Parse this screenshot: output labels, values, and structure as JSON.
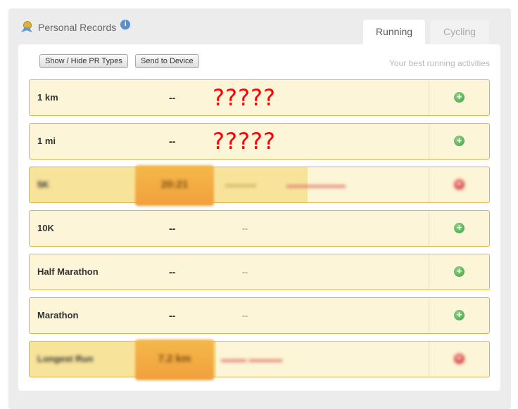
{
  "header": {
    "title": "Personal Records",
    "icon": "medal-icon",
    "info_icon": "info-icon"
  },
  "tabs": [
    {
      "label": "Running",
      "active": true
    },
    {
      "label": "Cycling",
      "active": false
    }
  ],
  "toolbar": {
    "show_hide": "Show / Hide PR Types",
    "send": "Send to Device"
  },
  "subtitle": "Your best running activities",
  "annotation": "?????",
  "rows": [
    {
      "name": "1 km",
      "time": "--",
      "date": "",
      "action": "add"
    },
    {
      "name": "1 mi",
      "time": "--",
      "date": "",
      "action": "add"
    },
    {
      "name": "5K",
      "time": "20:21",
      "date": "",
      "action": "remove"
    },
    {
      "name": "10K",
      "time": "--",
      "date": "--",
      "action": "add"
    },
    {
      "name": "Half Marathon",
      "time": "--",
      "date": "--",
      "action": "add"
    },
    {
      "name": "Marathon",
      "time": "--",
      "date": "--",
      "action": "add"
    },
    {
      "name": "Longest Run",
      "time": "7.2 km",
      "date": "",
      "action": "remove"
    }
  ],
  "colors": {
    "row_bg": "#fdf5d8",
    "row_border": "#d9b64c",
    "highlight": "#f2a03c",
    "add": "#3e9e3a",
    "remove": "#c02020",
    "annotation": "#ff0000"
  }
}
